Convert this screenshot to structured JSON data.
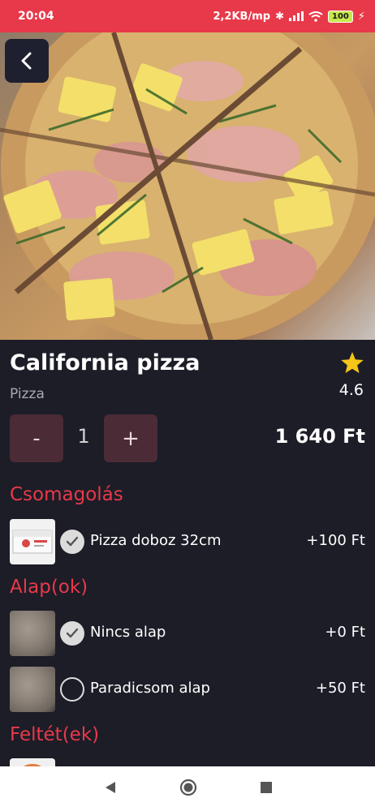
{
  "status_bar": {
    "time": "20:04",
    "network_speed": "2,2KB/mp",
    "battery": "100"
  },
  "product": {
    "title": "California pizza",
    "category": "Pizza",
    "rating": "4.6"
  },
  "quantity": {
    "minus_label": "-",
    "value": "1",
    "plus_label": "+"
  },
  "price": "1 640  Ft",
  "sections": [
    {
      "title": "Csomagolás",
      "options": [
        {
          "name": "Pizza doboz 32cm",
          "price": "+100  Ft",
          "selected": true
        }
      ]
    },
    {
      "title": "Alap(ok)",
      "options": [
        {
          "name": "Nincs alap",
          "price": "+0  Ft",
          "selected": true
        },
        {
          "name": "Paradicsom alap",
          "price": "+50  Ft",
          "selected": false
        }
      ]
    },
    {
      "title": "Feltét(ek)",
      "options": []
    }
  ],
  "colors": {
    "accent": "#e8394a",
    "background": "#1c1d27",
    "star": "#f5c518",
    "qty_button": "#4a2b36"
  },
  "icons": {
    "back": "chevron-left-icon",
    "rating": "star-icon",
    "selected": "check-icon",
    "nav_back": "triangle-back-icon",
    "nav_home": "circle-home-icon",
    "nav_recents": "square-recents-icon"
  }
}
